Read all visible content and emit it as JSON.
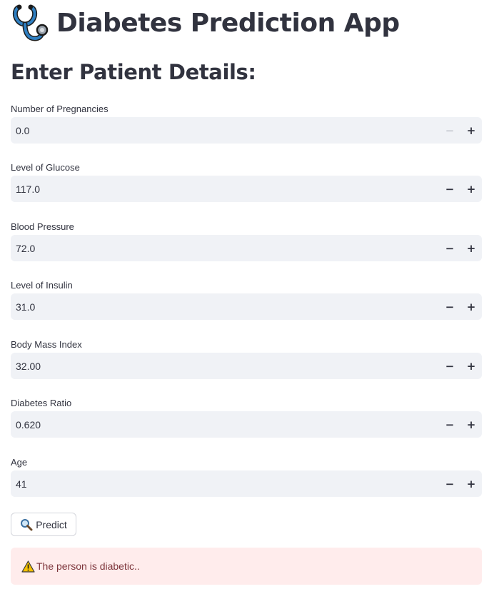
{
  "header": {
    "title": "Diabetes Prediction App",
    "title_icon": "stethoscope-icon"
  },
  "form": {
    "subheader": "Enter Patient Details:",
    "fields": [
      {
        "label": "Number of Pregnancies",
        "value": "0.0",
        "decrement_disabled": true
      },
      {
        "label": "Level of Glucose",
        "value": "117.0",
        "decrement_disabled": false
      },
      {
        "label": "Blood Pressure",
        "value": "72.0",
        "decrement_disabled": false
      },
      {
        "label": "Level of Insulin",
        "value": "31.0",
        "decrement_disabled": false
      },
      {
        "label": "Body Mass Index",
        "value": "32.00",
        "decrement_disabled": false
      },
      {
        "label": "Diabetes Ratio",
        "value": "0.620",
        "decrement_disabled": false
      },
      {
        "label": "Age",
        "value": "41",
        "decrement_disabled": false
      }
    ],
    "stepper": {
      "minus": "−",
      "plus": "+"
    }
  },
  "predict_button": {
    "label": "Predict",
    "icon": "magnifier-icon"
  },
  "result": {
    "message": "The person is diabetic..",
    "icon": "warning-icon",
    "colors": {
      "background": "#ffecec",
      "text": "#7d353b"
    }
  },
  "colors": {
    "input_background": "#f0f2f6",
    "text": "#31333f",
    "stethoscope_blue": "#2f7fc1"
  }
}
